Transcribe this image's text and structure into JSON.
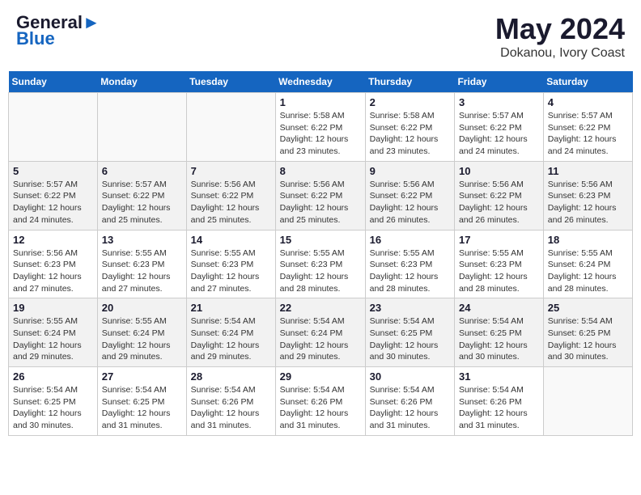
{
  "header": {
    "logo_line1": "General",
    "logo_line2": "Blue",
    "month_title": "May 2024",
    "location": "Dokanou, Ivory Coast"
  },
  "days_of_week": [
    "Sunday",
    "Monday",
    "Tuesday",
    "Wednesday",
    "Thursday",
    "Friday",
    "Saturday"
  ],
  "weeks": [
    [
      {
        "day": "",
        "info": ""
      },
      {
        "day": "",
        "info": ""
      },
      {
        "day": "",
        "info": ""
      },
      {
        "day": "1",
        "info": "Sunrise: 5:58 AM\nSunset: 6:22 PM\nDaylight: 12 hours\nand 23 minutes."
      },
      {
        "day": "2",
        "info": "Sunrise: 5:58 AM\nSunset: 6:22 PM\nDaylight: 12 hours\nand 23 minutes."
      },
      {
        "day": "3",
        "info": "Sunrise: 5:57 AM\nSunset: 6:22 PM\nDaylight: 12 hours\nand 24 minutes."
      },
      {
        "day": "4",
        "info": "Sunrise: 5:57 AM\nSunset: 6:22 PM\nDaylight: 12 hours\nand 24 minutes."
      }
    ],
    [
      {
        "day": "5",
        "info": "Sunrise: 5:57 AM\nSunset: 6:22 PM\nDaylight: 12 hours\nand 24 minutes."
      },
      {
        "day": "6",
        "info": "Sunrise: 5:57 AM\nSunset: 6:22 PM\nDaylight: 12 hours\nand 25 minutes."
      },
      {
        "day": "7",
        "info": "Sunrise: 5:56 AM\nSunset: 6:22 PM\nDaylight: 12 hours\nand 25 minutes."
      },
      {
        "day": "8",
        "info": "Sunrise: 5:56 AM\nSunset: 6:22 PM\nDaylight: 12 hours\nand 25 minutes."
      },
      {
        "day": "9",
        "info": "Sunrise: 5:56 AM\nSunset: 6:22 PM\nDaylight: 12 hours\nand 26 minutes."
      },
      {
        "day": "10",
        "info": "Sunrise: 5:56 AM\nSunset: 6:22 PM\nDaylight: 12 hours\nand 26 minutes."
      },
      {
        "day": "11",
        "info": "Sunrise: 5:56 AM\nSunset: 6:23 PM\nDaylight: 12 hours\nand 26 minutes."
      }
    ],
    [
      {
        "day": "12",
        "info": "Sunrise: 5:56 AM\nSunset: 6:23 PM\nDaylight: 12 hours\nand 27 minutes."
      },
      {
        "day": "13",
        "info": "Sunrise: 5:55 AM\nSunset: 6:23 PM\nDaylight: 12 hours\nand 27 minutes."
      },
      {
        "day": "14",
        "info": "Sunrise: 5:55 AM\nSunset: 6:23 PM\nDaylight: 12 hours\nand 27 minutes."
      },
      {
        "day": "15",
        "info": "Sunrise: 5:55 AM\nSunset: 6:23 PM\nDaylight: 12 hours\nand 28 minutes."
      },
      {
        "day": "16",
        "info": "Sunrise: 5:55 AM\nSunset: 6:23 PM\nDaylight: 12 hours\nand 28 minutes."
      },
      {
        "day": "17",
        "info": "Sunrise: 5:55 AM\nSunset: 6:23 PM\nDaylight: 12 hours\nand 28 minutes."
      },
      {
        "day": "18",
        "info": "Sunrise: 5:55 AM\nSunset: 6:24 PM\nDaylight: 12 hours\nand 28 minutes."
      }
    ],
    [
      {
        "day": "19",
        "info": "Sunrise: 5:55 AM\nSunset: 6:24 PM\nDaylight: 12 hours\nand 29 minutes."
      },
      {
        "day": "20",
        "info": "Sunrise: 5:55 AM\nSunset: 6:24 PM\nDaylight: 12 hours\nand 29 minutes."
      },
      {
        "day": "21",
        "info": "Sunrise: 5:54 AM\nSunset: 6:24 PM\nDaylight: 12 hours\nand 29 minutes."
      },
      {
        "day": "22",
        "info": "Sunrise: 5:54 AM\nSunset: 6:24 PM\nDaylight: 12 hours\nand 29 minutes."
      },
      {
        "day": "23",
        "info": "Sunrise: 5:54 AM\nSunset: 6:25 PM\nDaylight: 12 hours\nand 30 minutes."
      },
      {
        "day": "24",
        "info": "Sunrise: 5:54 AM\nSunset: 6:25 PM\nDaylight: 12 hours\nand 30 minutes."
      },
      {
        "day": "25",
        "info": "Sunrise: 5:54 AM\nSunset: 6:25 PM\nDaylight: 12 hours\nand 30 minutes."
      }
    ],
    [
      {
        "day": "26",
        "info": "Sunrise: 5:54 AM\nSunset: 6:25 PM\nDaylight: 12 hours\nand 30 minutes."
      },
      {
        "day": "27",
        "info": "Sunrise: 5:54 AM\nSunset: 6:25 PM\nDaylight: 12 hours\nand 31 minutes."
      },
      {
        "day": "28",
        "info": "Sunrise: 5:54 AM\nSunset: 6:26 PM\nDaylight: 12 hours\nand 31 minutes."
      },
      {
        "day": "29",
        "info": "Sunrise: 5:54 AM\nSunset: 6:26 PM\nDaylight: 12 hours\nand 31 minutes."
      },
      {
        "day": "30",
        "info": "Sunrise: 5:54 AM\nSunset: 6:26 PM\nDaylight: 12 hours\nand 31 minutes."
      },
      {
        "day": "31",
        "info": "Sunrise: 5:54 AM\nSunset: 6:26 PM\nDaylight: 12 hours\nand 31 minutes."
      },
      {
        "day": "",
        "info": ""
      }
    ]
  ]
}
